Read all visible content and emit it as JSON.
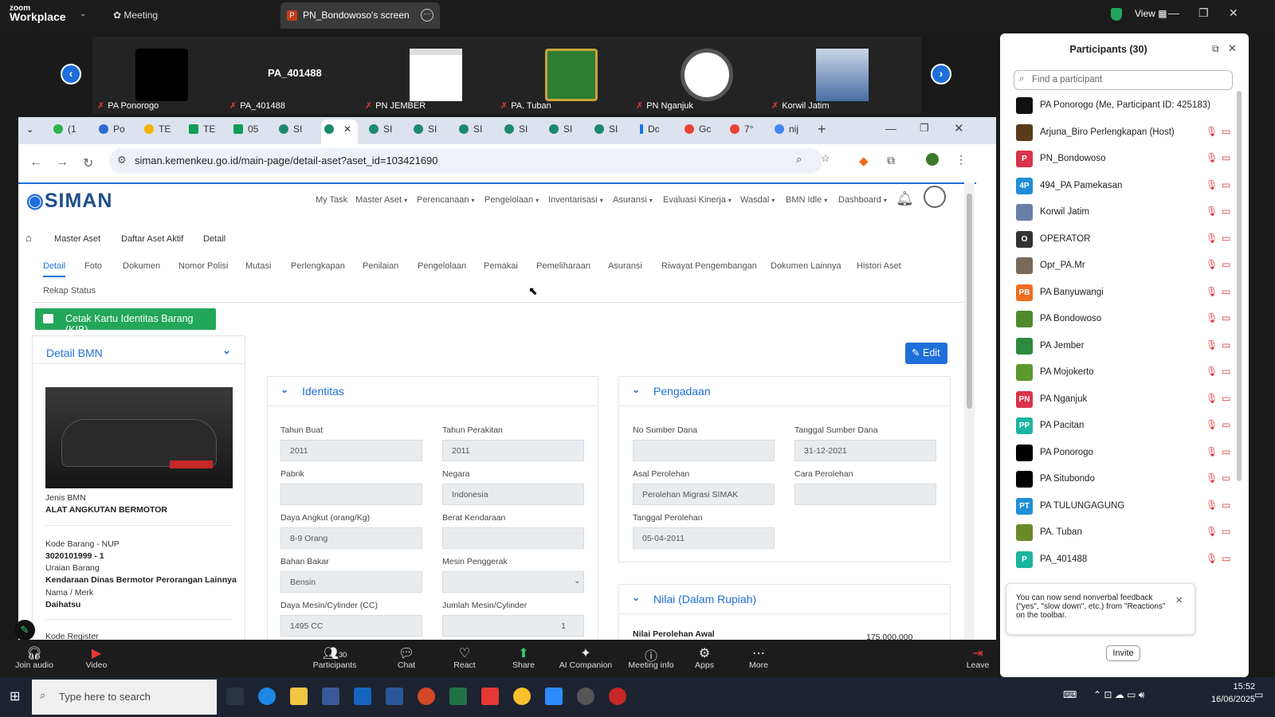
{
  "zoom": {
    "brand_top": "zoom",
    "brand_bottom": "Workplace",
    "meeting_label": "Meeting",
    "share_tab": "PN_Bondowoso's screen",
    "view_label": "View"
  },
  "strip": {
    "center_label": "PA_401488",
    "tiles": [
      {
        "name": "PA Ponorogo"
      },
      {
        "name": "PA_401488"
      },
      {
        "name": "PN JEMBER"
      },
      {
        "name": "PA. Tuban"
      },
      {
        "name": "PN Nganjuk"
      },
      {
        "name": "Korwil Jatim"
      }
    ]
  },
  "browser": {
    "tabs": [
      "(1",
      "Po",
      "TE",
      "TE",
      "05",
      "SI",
      "",
      "SI",
      "SI",
      "SI",
      "SI",
      "SI",
      "SI",
      "Dc",
      "Gc",
      "7°",
      "nij"
    ],
    "url": "siman.kemenkeu.go.id/main-page/detail-aset?aset_id=103421690"
  },
  "site": {
    "logo": "SIMAN",
    "menu": [
      "My Task",
      "Master Aset",
      "Perencanaan",
      "Pengelolaan",
      "Inventarisasi",
      "Asuransi",
      "Evaluasi Kinerja",
      "Wasdal",
      "BMN Idle",
      "Dashboard"
    ],
    "breadcrumb": [
      "Master Aset",
      "Daftar Aset Aktif",
      "Detail"
    ],
    "tabs": [
      "Detail",
      "Foto",
      "Dokumen",
      "Nomor Polisi",
      "Mutasi",
      "Perlengkapan",
      "Penilaian",
      "Pengelolaan",
      "Pemakai",
      "Pemeliharaan",
      "Asuransi",
      "Riwayat Pengembangan",
      "Dokumen Lainnya",
      "Histori Aset"
    ],
    "tab_row2": "Rekap Status",
    "print_button": "Cetak Kartu Identitas Barang (KIB)",
    "edit_button": "Edit",
    "detail_bmn": {
      "title": "Detail BMN",
      "jenis_label": "Jenis BMN",
      "jenis_value": "ALAT ANGKUTAN BERMOTOR",
      "kode_label": "Kode Barang - NUP",
      "kode_value": "3020101999 - 1",
      "uraian_label": "Uraian Barang",
      "uraian_value": "Kendaraan Dinas Bermotor Perorangan Lainnya",
      "merk_label": "Nama / Merk",
      "merk_value": "Daihatsu",
      "register_label": "Kode Register"
    },
    "identitas": {
      "title": "Identitas",
      "fields": [
        {
          "label": "Tahun Buat",
          "value": "2011"
        },
        {
          "label": "Tahun Perakitan",
          "value": "2011"
        },
        {
          "label": "Pabrik",
          "value": ""
        },
        {
          "label": "Negara",
          "value": "Indonesia"
        },
        {
          "label": "Daya Angkut (orang/Kg)",
          "value": "8-9 Orang"
        },
        {
          "label": "Berat Kendaraan",
          "value": ""
        },
        {
          "label": "Bahan Bakar",
          "value": "Bensin"
        },
        {
          "label": "Mesin Penggerak",
          "value": ""
        },
        {
          "label": "Daya Mesin/Cylinder (CC)",
          "value": "1495 CC"
        },
        {
          "label": "Jumlah Mesin/Cylinder",
          "value": "1"
        }
      ]
    },
    "pengadaan": {
      "title": "Pengadaan",
      "fields": [
        {
          "label": "No Sumber Dana",
          "value": ""
        },
        {
          "label": "Tanggal Sumber Dana",
          "value": "31-12-2021"
        },
        {
          "label": "Asal Perolehan",
          "value": "Perolehan Migrasi SIMAK"
        },
        {
          "label": "Cara Perolehan",
          "value": ""
        },
        {
          "label": "Tanggal Perolehan",
          "value": "05-04-2011"
        }
      ]
    },
    "nilai": {
      "title": "Nilai (Dalam Rupiah)",
      "first_label": "Nilai Perolehan Awal",
      "first_value": "175.000.000"
    }
  },
  "bottom": {
    "items": [
      "Join audio",
      "Video",
      "Participants",
      "Chat",
      "React",
      "Share",
      "AI Companion",
      "Meeting info",
      "Apps",
      "More",
      "Leave"
    ],
    "participants_count": "30"
  },
  "participants": {
    "title": "Participants (30)",
    "search_placeholder": "Find a participant",
    "list": [
      {
        "name": "PA Ponorogo (Me, Participant ID: 425183)",
        "av": "",
        "color": "#111111"
      },
      {
        "name": "Arjuna_Biro Perlengkapan (Host)",
        "av": "",
        "color": "#5a3b1c"
      },
      {
        "name": "PN_Bondowoso",
        "av": "P",
        "color": "#d9334a"
      },
      {
        "name": "494_PA Pamekasan",
        "av": "4P",
        "color": "#1e8fd6"
      },
      {
        "name": "Korwil Jatim",
        "av": "",
        "color": "#6a7fa8"
      },
      {
        "name": "OPERATOR",
        "av": "O",
        "color": "#333333"
      },
      {
        "name": "Opr_PA.Mr",
        "av": "",
        "color": "#7a6a5a"
      },
      {
        "name": "PA Banyuwangi",
        "av": "PB",
        "color": "#ef6c1e"
      },
      {
        "name": "PA Bondowoso",
        "av": "",
        "color": "#4f8a2a"
      },
      {
        "name": "PA Jember",
        "av": "",
        "color": "#2d8a3e"
      },
      {
        "name": "PA Mojokerto",
        "av": "",
        "color": "#5c9a2c"
      },
      {
        "name": "PA Nganjuk",
        "av": "PN",
        "color": "#d9334a"
      },
      {
        "name": "PA Pacitan",
        "av": "PP",
        "color": "#1bb5a0"
      },
      {
        "name": "PA Ponorogo",
        "av": "",
        "color": "#000000"
      },
      {
        "name": "PA Situbondo",
        "av": "",
        "color": "#000000"
      },
      {
        "name": "PA TULUNGAGUNG",
        "av": "PT",
        "color": "#1e8fd6"
      },
      {
        "name": "PA. Tuban",
        "av": "",
        "color": "#6a8a2a"
      },
      {
        "name": "PA_401488",
        "av": "P",
        "color": "#1bb5a0"
      }
    ],
    "toast": "You can now send nonverbal feedback (\"yes\", \"slow down\", etc.) from \"Reactions\" on the toolbar.",
    "invite": "Invite"
  },
  "taskbar": {
    "search_placeholder": "Type here to search",
    "time": "15:52",
    "date": "16/06/2025"
  }
}
